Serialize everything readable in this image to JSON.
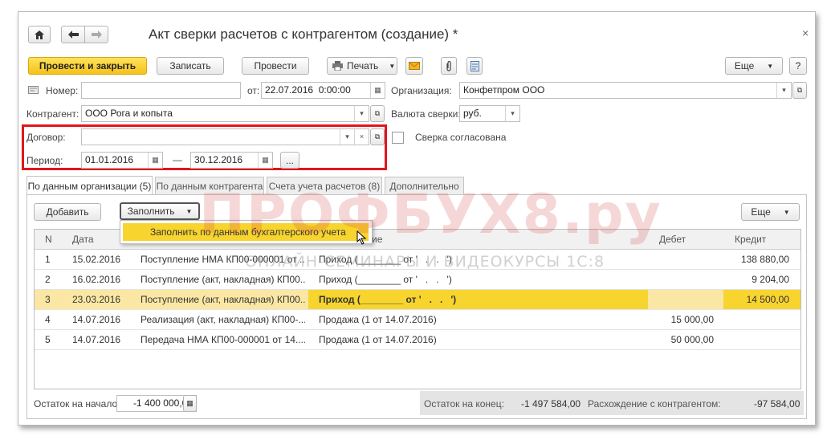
{
  "window": {
    "title": "Акт сверки расчетов с контрагентом (создание) *"
  },
  "toolbar": {
    "post_close": "Провести и закрыть",
    "save": "Записать",
    "post": "Провести",
    "print": "Печать",
    "more": "Еще",
    "help": "?"
  },
  "form": {
    "number_label": "Номер:",
    "number_value": "",
    "from_label": "от:",
    "date_value": "22.07.2016  0:00:00",
    "org_label": "Организация:",
    "org_value": "Конфетпром ООО",
    "counterparty_label": "Контрагент:",
    "counterparty_value": "ООО Рога и копыта",
    "currency_label": "Валюта сверки:",
    "currency_value": "руб.",
    "contract_label": "Договор:",
    "contract_value": "",
    "agreed_label": "Сверка согласована",
    "period_label": "Период:",
    "period_from": "01.01.2016",
    "period_dash": "—",
    "period_to": "30.12.2016",
    "period_more": "..."
  },
  "tabs": [
    {
      "label": "По данным организации (5)"
    },
    {
      "label": "По данным контрагента"
    },
    {
      "label": "Счета учета расчетов (8)"
    },
    {
      "label": "Дополнительно"
    }
  ],
  "table_toolbar": {
    "add": "Добавить",
    "fill": "Заполнить",
    "more": "Еще",
    "fill_menu_item": "Заполнить по данным бухгалтерского учета"
  },
  "table": {
    "headers": {
      "n": "N",
      "date": "Дата",
      "name_tail": "ие",
      "debit": "Дебет",
      "credit": "Кредит"
    },
    "rows": [
      {
        "n": "1",
        "date": "15.02.2016",
        "doc": "Поступление НМА КП00-000001 от ...",
        "desc": "Приход (________ от '   .   .   ')",
        "debit": "",
        "credit": "138 880,00"
      },
      {
        "n": "2",
        "date": "16.02.2016",
        "doc": "Поступление (акт, накладная) КП00...",
        "desc": "Приход (________ от '   .   .   ')",
        "debit": "",
        "credit": "9 204,00"
      },
      {
        "n": "3",
        "date": "23.03.2016",
        "doc": "Поступление (акт, накладная) КП00...",
        "desc": "Приход (________ от '   .   .   ')",
        "debit": "",
        "credit": "14 500,00"
      },
      {
        "n": "4",
        "date": "14.07.2016",
        "doc": "Реализация (акт, накладная) КП00-...",
        "desc": "Продажа (1 от 14.07.2016)",
        "debit": "15 000,00",
        "credit": ""
      },
      {
        "n": "5",
        "date": "14.07.2016",
        "doc": "Передача НМА КП00-000001 от 14....",
        "desc": "Продажа (1 от 14.07.2016)",
        "debit": "50 000,00",
        "credit": ""
      }
    ]
  },
  "footer": {
    "start_balance_label": "Остаток на начало:",
    "start_balance_value": "-1 400 000,00",
    "end_balance_label": "Остаток на конец:",
    "end_balance_value": "-1 497 584,00",
    "diff_label": "Расхождение с контрагентом:",
    "diff_value": "-97 584,00"
  },
  "watermark": {
    "main": "ПРОФБУХ8.ру",
    "sub": "ОНЛАЙН-СЕМИНАРЫ И ВИДЕОКУРСЫ 1С:8"
  },
  "colors": {
    "accent_yellow": "#f5c21b",
    "highlight_red": "#e0161b",
    "selected_row": "#fbe7a4"
  }
}
